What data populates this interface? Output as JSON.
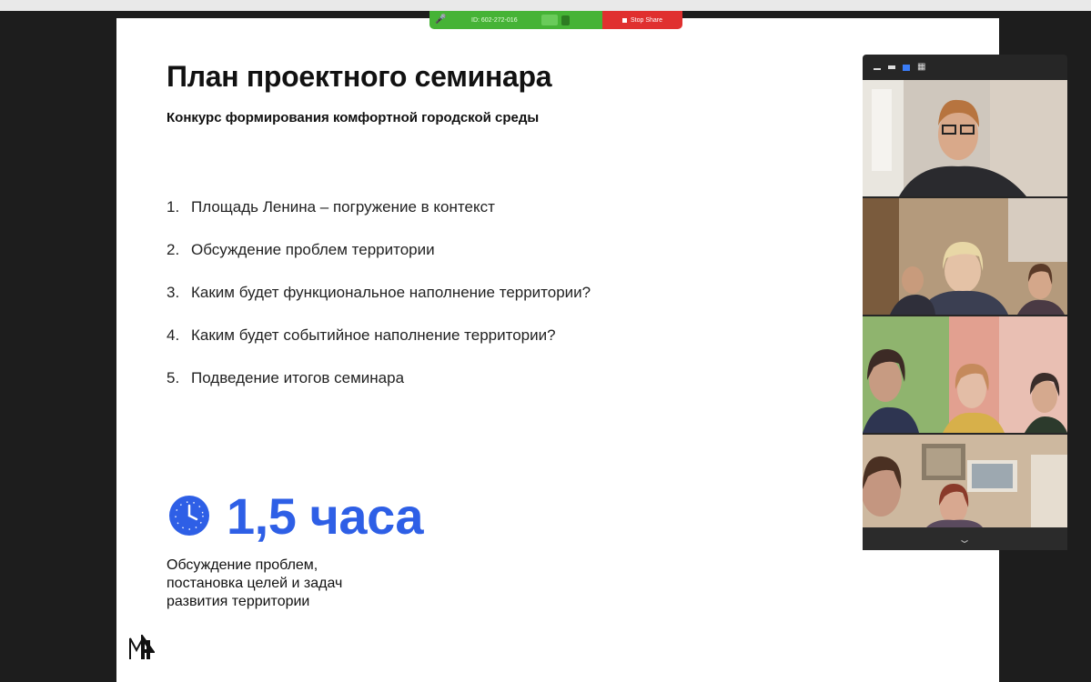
{
  "share_bar": {
    "meeting_id": "ID: 602-272-016",
    "stop_share_label": "Stop Share"
  },
  "slide": {
    "title": "План проектного семинара",
    "subtitle": "Конкурс формирования комфортной городской среды",
    "agenda": [
      {
        "num": "1.",
        "text": "Площадь Ленина – погружение в контекст"
      },
      {
        "num": "2.",
        "text": "Обсуждение проблем территории"
      },
      {
        "num": "3.",
        "text": "Каким будет функциональное наполнение территории?"
      },
      {
        "num": "4.",
        "text": "Каким будет событийное наполнение территории?"
      },
      {
        "num": "5.",
        "text": "Подведение итогов семинара"
      }
    ],
    "duration": "1,5 часа",
    "description_lines": [
      "Обсуждение проблем,",
      "постановка целей и задач",
      "развития территории"
    ],
    "accent_color": "#2e5fe6"
  },
  "video_panel": {
    "icons": [
      "minimize-icon",
      "single-view-icon",
      "active-speaker-view-icon",
      "gallery-view-icon"
    ],
    "participants": [
      "participant-video-1",
      "participant-video-2",
      "participant-video-3",
      "participant-video-4"
    ],
    "scroll_icon": "chevron-down-icon"
  }
}
